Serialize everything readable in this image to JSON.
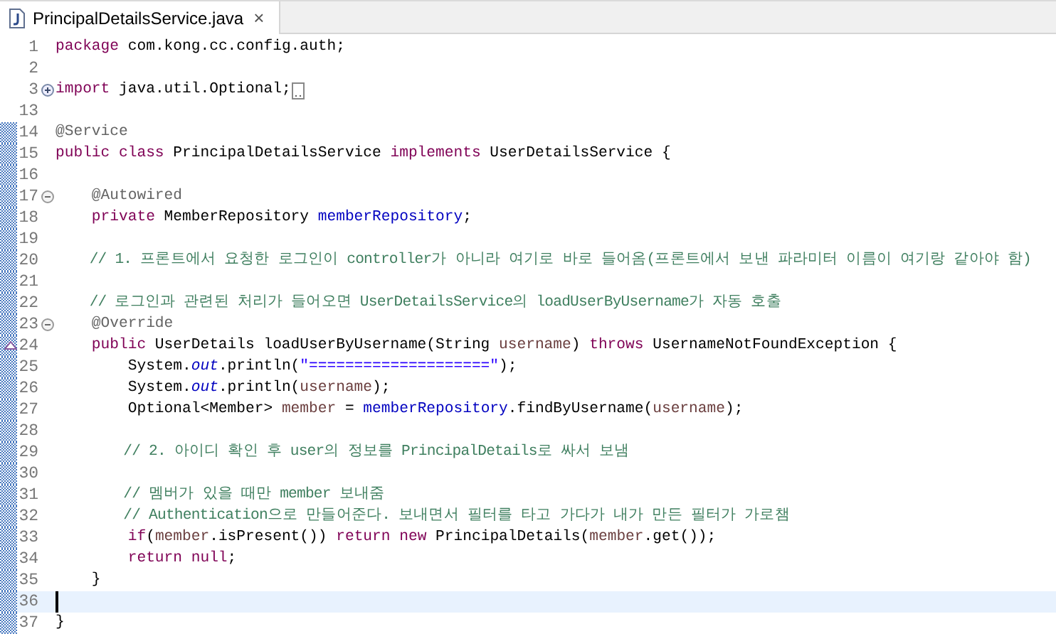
{
  "tabs": [
    {
      "title": "PrincipalDetailsService.java",
      "close": "×",
      "selected": true
    }
  ],
  "lines": [
    {
      "number": "1",
      "changed": false,
      "current": false,
      "tokens": [
        {
          "kind": "keyword",
          "text": "package"
        },
        {
          "kind": "plain",
          "text": " com.kong.cc.config.auth;"
        }
      ]
    },
    {
      "number": "2",
      "changed": false,
      "current": false
    },
    {
      "number": "3",
      "fold": {
        "expanded": false
      },
      "changed": false,
      "current": false,
      "folded_marker": true,
      "tokens": [
        {
          "kind": "keyword",
          "text": "import"
        },
        {
          "kind": "plain",
          "text": " java.util.Optional;"
        }
      ]
    },
    {
      "number": "13",
      "changed": false,
      "current": false
    },
    {
      "number": "14",
      "changed": true,
      "current": false,
      "tokens": [
        {
          "kind": "annotation",
          "text": "@Service"
        }
      ]
    },
    {
      "number": "15",
      "changed": true,
      "current": false,
      "tokens": [
        {
          "kind": "keyword",
          "text": "public class"
        },
        {
          "kind": "plain",
          "text": " PrincipalDetailsService "
        },
        {
          "kind": "keyword",
          "text": "implements"
        },
        {
          "kind": "plain",
          "text": " UserDetailsService {"
        }
      ]
    },
    {
      "number": "16",
      "changed": true,
      "current": false
    },
    {
      "number": "17",
      "fold": {
        "expanded": true
      },
      "changed": true,
      "current": false,
      "tokens": [
        {
          "kind": "annotation",
          "text": "    @Autowired"
        }
      ]
    },
    {
      "number": "18",
      "changed": true,
      "current": false,
      "tokens": [
        {
          "kind": "keyword",
          "text": "    private"
        },
        {
          "kind": "plain",
          "text": " MemberRepository "
        },
        {
          "kind": "field",
          "text": "memberRepository"
        },
        {
          "kind": "plain",
          "text": ";"
        }
      ]
    },
    {
      "number": "19",
      "changed": true,
      "current": false
    },
    {
      "number": "20",
      "changed": true,
      "current": false,
      "tokens": [
        {
          "kind": "comment",
          "text": "    // 1. 프론트에서 요청한 로그인이 controller가 아니라 여기로 바로 들어옴(프론트에서 보낸 파라미터 이름이 여기랑 같아야 함)"
        }
      ]
    },
    {
      "number": "21",
      "changed": true,
      "current": false
    },
    {
      "number": "22",
      "changed": true,
      "current": false,
      "tokens": [
        {
          "kind": "comment",
          "text": "    // 로그인과 관련된 처리가 들어오면 UserDetailsService의 loadUserByUsername가 자동 호출"
        }
      ]
    },
    {
      "number": "23",
      "fold": {
        "expanded": true
      },
      "changed": true,
      "current": false,
      "tokens": [
        {
          "kind": "annotation",
          "text": "    @Override"
        }
      ]
    },
    {
      "number": "24",
      "changed": true,
      "current": false,
      "override": true,
      "tokens": [
        {
          "kind": "keyword",
          "text": "    public"
        },
        {
          "kind": "plain",
          "text": " UserDetails loadUserByUsername(String "
        },
        {
          "kind": "local",
          "text": "username"
        },
        {
          "kind": "plain",
          "text": ") "
        },
        {
          "kind": "keyword",
          "text": "throws"
        },
        {
          "kind": "plain",
          "text": " UsernameNotFoundException {"
        }
      ]
    },
    {
      "number": "25",
      "changed": true,
      "current": false,
      "tokens": [
        {
          "kind": "plain",
          "text": "        System."
        },
        {
          "kind": "static",
          "text": "out"
        },
        {
          "kind": "plain",
          "text": ".println("
        },
        {
          "kind": "string",
          "text": "\"====================\""
        },
        {
          "kind": "plain",
          "text": ");"
        }
      ]
    },
    {
      "number": "26",
      "changed": true,
      "current": false,
      "tokens": [
        {
          "kind": "plain",
          "text": "        System."
        },
        {
          "kind": "static",
          "text": "out"
        },
        {
          "kind": "plain",
          "text": ".println("
        },
        {
          "kind": "local",
          "text": "username"
        },
        {
          "kind": "plain",
          "text": ");"
        }
      ]
    },
    {
      "number": "27",
      "changed": true,
      "current": false,
      "tokens": [
        {
          "kind": "plain",
          "text": "        Optional<Member> "
        },
        {
          "kind": "local",
          "text": "member"
        },
        {
          "kind": "plain",
          "text": " = "
        },
        {
          "kind": "field",
          "text": "memberRepository"
        },
        {
          "kind": "plain",
          "text": ".findByUsername("
        },
        {
          "kind": "local",
          "text": "username"
        },
        {
          "kind": "plain",
          "text": ");"
        }
      ]
    },
    {
      "number": "28",
      "changed": true,
      "current": false
    },
    {
      "number": "29",
      "changed": true,
      "current": false,
      "tokens": [
        {
          "kind": "comment",
          "text": "        // 2. 아이디 확인 후 user의 정보를 PrincipalDetails로 싸서 보냄"
        }
      ]
    },
    {
      "number": "30",
      "changed": true,
      "current": false
    },
    {
      "number": "31",
      "changed": true,
      "current": false,
      "tokens": [
        {
          "kind": "comment",
          "text": "        // 멤버가 있을 때만 member 보내줌"
        }
      ]
    },
    {
      "number": "32",
      "changed": true,
      "current": false,
      "tokens": [
        {
          "kind": "comment",
          "text": "        // Authentication으로 만들어준다. 보내면서 필터를 타고 가다가 내가 만든 필터가 가로챔"
        }
      ]
    },
    {
      "number": "33",
      "changed": true,
      "current": false,
      "tokens": [
        {
          "kind": "keyword",
          "text": "        if"
        },
        {
          "kind": "plain",
          "text": "("
        },
        {
          "kind": "local",
          "text": "member"
        },
        {
          "kind": "plain",
          "text": ".isPresent()) "
        },
        {
          "kind": "keyword",
          "text": "return new"
        },
        {
          "kind": "plain",
          "text": " PrincipalDetails("
        },
        {
          "kind": "local",
          "text": "member"
        },
        {
          "kind": "plain",
          "text": ".get());"
        }
      ]
    },
    {
      "number": "34",
      "changed": true,
      "current": false,
      "tokens": [
        {
          "kind": "keyword",
          "text": "        return null"
        },
        {
          "kind": "plain",
          "text": ";"
        }
      ]
    },
    {
      "number": "35",
      "changed": true,
      "current": false,
      "tokens": [
        {
          "kind": "plain",
          "text": "    }"
        }
      ]
    },
    {
      "number": "36",
      "changed": true,
      "current": true
    },
    {
      "number": "37",
      "changed": true,
      "current": false,
      "tokens": [
        {
          "kind": "plain",
          "text": "}"
        }
      ]
    }
  ]
}
